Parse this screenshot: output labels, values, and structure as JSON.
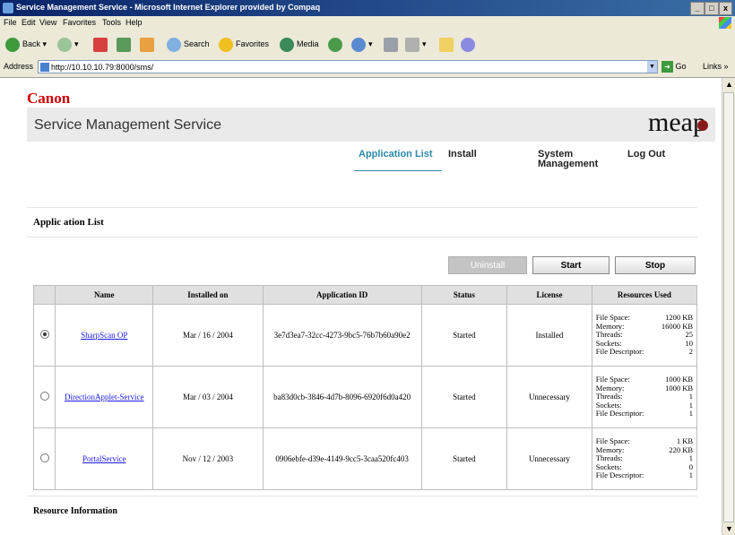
{
  "browser": {
    "window_title": "Service Management Service - Microsoft Internet Explorer provided by Compaq",
    "window_buttons": {
      "minimize": "_",
      "maximize": "□",
      "close": "x"
    },
    "menu": [
      "File",
      "Edit",
      "View",
      "Favorites",
      "Tools",
      "Help"
    ],
    "toolbar": {
      "back": "Back",
      "search": "Search",
      "favorites": "Favorites",
      "media": "Media"
    },
    "address_label": "Address",
    "address_url": "http://10.10.10.79:8000/sms/",
    "go_label": "Go",
    "links_label": "Links",
    "scroll_up": "▲",
    "scroll_down": "▼"
  },
  "page": {
    "brand": "Canon",
    "service_title": "Service Management Service",
    "logo_text": "meap",
    "nav": [
      {
        "label": "Application List"
      },
      {
        "label": "Install"
      },
      {
        "label": "System\nManagement"
      },
      {
        "label": "Log Out"
      }
    ],
    "section_title": "Applic ation List",
    "buttons": {
      "uninstall": "Uninstall",
      "start": "Start",
      "stop": "Stop"
    },
    "table": {
      "headers": [
        "Name",
        "Installed on",
        "Application ID",
        "Status",
        "License",
        "Resources Used"
      ],
      "rows": [
        {
          "selected": true,
          "name": "SharpScan OP",
          "installed_on": "Mar / 16 / 2004",
          "app_id": "3e7d3ea7-32cc-4273-9bc5-76b7b60a90e2",
          "status": "Started",
          "license": "Installed",
          "resources": [
            {
              "label": "File Space:",
              "value": "1200 KB"
            },
            {
              "label": "Memory:",
              "value": "16000 KB"
            },
            {
              "label": "Threads:",
              "value": "25"
            },
            {
              "label": "Sockets:",
              "value": "10"
            },
            {
              "label": "File Descriptor:",
              "value": "2"
            }
          ]
        },
        {
          "selected": false,
          "name": "DirectionApplet-Service",
          "installed_on": "Mar / 03 / 2004",
          "app_id": "ba83d0cb-3846-4d7b-8096-6920f6d0a420",
          "status": "Started",
          "license": "Unnecessary",
          "resources": [
            {
              "label": "File Space:",
              "value": "1000 KB"
            },
            {
              "label": "Memory:",
              "value": "1000 KB"
            },
            {
              "label": "Threads:",
              "value": "1"
            },
            {
              "label": "Sockets:",
              "value": "1"
            },
            {
              "label": "File Descriptor:",
              "value": "1"
            }
          ]
        },
        {
          "selected": false,
          "name": "PortalService",
          "installed_on": "Nov / 12 / 2003",
          "app_id": "0906ebfe-d39e-4149-9cc5-3caa520fc403",
          "status": "Started",
          "license": "Unnecessary",
          "resources": [
            {
              "label": "File Space:",
              "value": "1 KB"
            },
            {
              "label": "Memory:",
              "value": "220 KB"
            },
            {
              "label": "Threads:",
              "value": "1"
            },
            {
              "label": "Sockets:",
              "value": "0"
            },
            {
              "label": "File Descriptor:",
              "value": "1"
            }
          ]
        }
      ]
    },
    "resource_info_title": "Resource Information"
  }
}
